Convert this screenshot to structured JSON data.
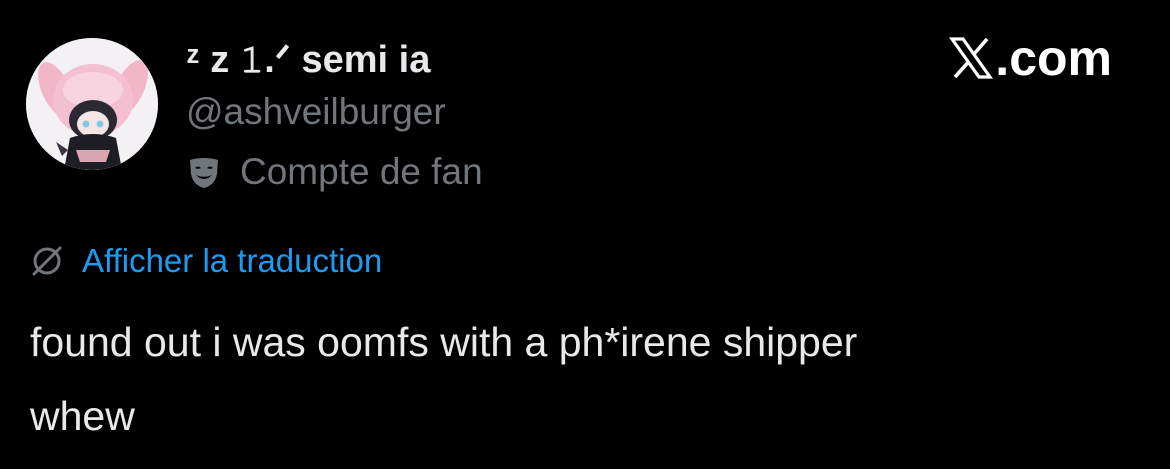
{
  "tweet": {
    "author": {
      "display_name": "ᶻ z 𝟷.ᐟ semi ia",
      "handle": "@ashveilburger",
      "label": "Compte de fan",
      "label_icon": "theater-mask-icon",
      "avatar": "profile-avatar-anime-pink-hood"
    },
    "translate_label": "Afficher la traduction",
    "translate_icon": "translate-icon",
    "text_lines": [
      "found out i was oomfs with a ph*irene shipper",
      "whew"
    ]
  },
  "brand": {
    "icon": "x-logo-icon",
    "text": ".com"
  },
  "colors": {
    "background": "#000000",
    "primary_text": "#e7e9ea",
    "secondary_text": "#71767b",
    "link": "#1d9bf0"
  }
}
